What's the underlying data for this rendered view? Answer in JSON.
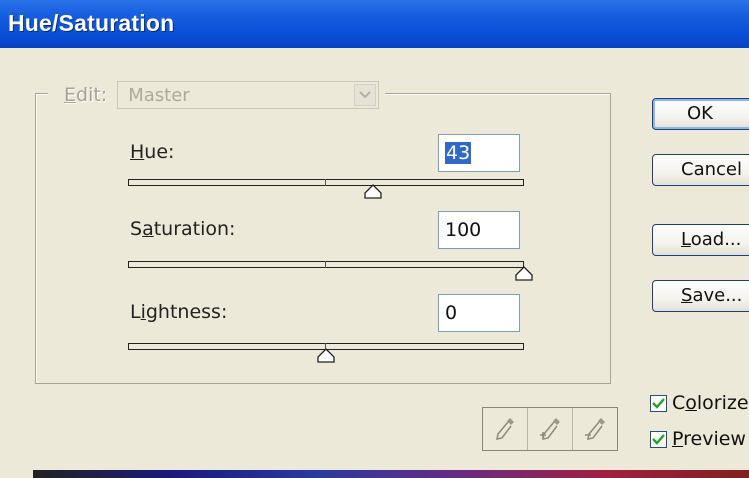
{
  "window": {
    "title": "Hue/Saturation"
  },
  "edit": {
    "label": "Edit:",
    "value": "Master"
  },
  "hue": {
    "label": "Hue:",
    "value": "43",
    "slider_min": -180,
    "slider_max": 180,
    "slider_value": 43
  },
  "saturation": {
    "label": "Saturation:",
    "value": "100",
    "slider_min": -100,
    "slider_max": 100,
    "slider_value": 100
  },
  "lightness": {
    "label": "Lightness:",
    "value": "0",
    "slider_min": -100,
    "slider_max": 100,
    "slider_value": 0
  },
  "buttons": {
    "ok": "OK",
    "cancel": "Cancel",
    "load": "Load...",
    "save": "Save..."
  },
  "checkboxes": {
    "colorize": {
      "label": "Colorize",
      "checked": true
    },
    "preview": {
      "label": "Preview",
      "checked": true
    }
  },
  "icons": [
    "eyedropper-icon",
    "eyedropper-plus-icon",
    "eyedropper-minus-icon",
    "chevron-down-icon",
    "checkmark-icon"
  ],
  "colors": {
    "title_bar": "#0a4fd8",
    "selection": "#316ac5",
    "check": "#21a121"
  }
}
